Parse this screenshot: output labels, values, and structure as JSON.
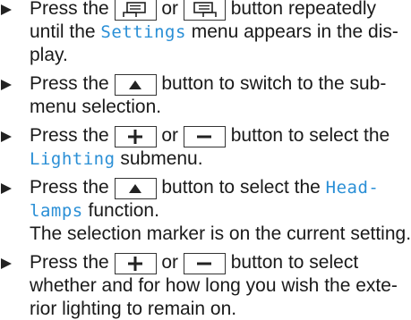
{
  "lines": [
    {
      "pre": "Press the ",
      "mid": " or ",
      "post": " button repeatedly"
    },
    {
      "text": "until the ",
      "hl": "Settings",
      "post": " menu appears in the dis-"
    },
    {
      "text": "play."
    },
    {
      "pre": "Press the ",
      "post": " button to switch to the sub-"
    },
    {
      "text": "menu selection."
    },
    {
      "pre": "Press the ",
      "mid": " or ",
      "post": " button to select the"
    },
    {
      "hl": "Lighting",
      "post": " submenu."
    },
    {
      "pre": "Press the ",
      "post": " button to select the ",
      "hl": "Head-"
    },
    {
      "hl": "lamps",
      "post": " function."
    },
    {
      "text": "The selection marker is on the current setting."
    },
    {
      "pre": "Press the ",
      "mid": " or ",
      "post": " button to select"
    },
    {
      "text": "whether and for how long you wish the exte-"
    },
    {
      "text": "rior lighting to remain on."
    }
  ],
  "icons": {
    "bullet": "triangle-right",
    "display_left": "display-left-icon",
    "display_right": "display-right-icon",
    "up": "up-triangle-icon",
    "plus": "plus-icon",
    "minus": "minus-icon"
  },
  "colors": {
    "text": "#1a1a1a",
    "highlight": "#2a8fd6"
  }
}
